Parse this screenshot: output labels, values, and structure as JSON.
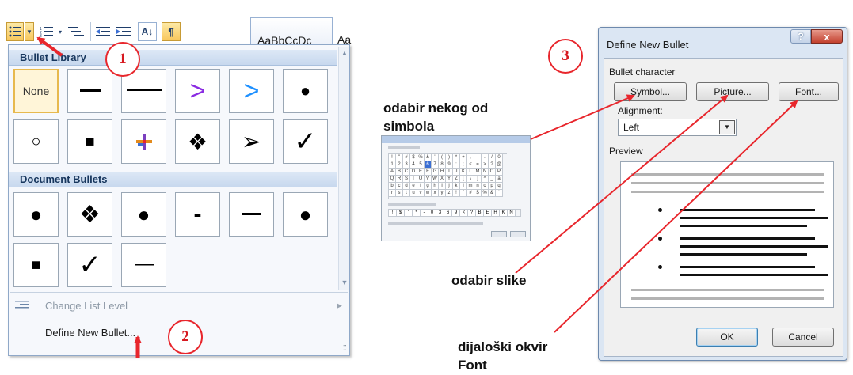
{
  "ribbon": {
    "style_preview_1": "AaBbCcDc",
    "style_preview_2": "Aa",
    "sort_icon_text": "A↓",
    "pilcrow": "¶"
  },
  "gallery": {
    "bullet_library_heading": "Bullet Library",
    "library_items": [
      {
        "label": "None",
        "icon": "none"
      },
      {
        "label": "—",
        "icon": "short-dash-bullet"
      },
      {
        "label": "——",
        "icon": "long-dash-bullet"
      },
      {
        "label": ">",
        "icon": "purple-chevron-bullet"
      },
      {
        "label": ">",
        "icon": "blue-chevron-bullet"
      },
      {
        "label": "●",
        "icon": "filled-circle-bullet"
      },
      {
        "label": "○",
        "icon": "hollow-circle-bullet"
      },
      {
        "label": "■",
        "icon": "filled-square-bullet"
      },
      {
        "label": "✢",
        "icon": "color-cross-bullet"
      },
      {
        "label": "❖",
        "icon": "diamond-cluster-bullet"
      },
      {
        "label": "➢",
        "icon": "arrowhead-bullet"
      },
      {
        "label": "✓",
        "icon": "checkmark-bullet"
      }
    ],
    "document_bullets_heading": "Document Bullets",
    "document_items": [
      {
        "label": "●",
        "icon": "filled-circle-bullet"
      },
      {
        "label": "❖",
        "icon": "diamond-cluster-bullet"
      },
      {
        "label": "●",
        "icon": "filled-circle-bullet"
      },
      {
        "label": "-",
        "icon": "hyphen-bullet"
      },
      {
        "label": "—",
        "icon": "dash-bullet"
      },
      {
        "label": "●",
        "icon": "filled-circle-bullet"
      },
      {
        "label": "■",
        "icon": "filled-square-bullet"
      },
      {
        "label": "✓",
        "icon": "checkmark-bullet"
      },
      {
        "label": "—",
        "icon": "thin-dash-bullet"
      }
    ],
    "change_list_level": "Change List Level",
    "define_new_bullet": "Define New Bullet..."
  },
  "callouts": {
    "one": "1",
    "two": "2",
    "three": "3"
  },
  "annotations": {
    "symbol_line1": "odabir nekog od",
    "symbol_line2": "simbola",
    "picture": "odabir slike",
    "font_line1": "dijaloški okvir",
    "font_line2": "Font"
  },
  "dialog": {
    "title": "Define New Bullet",
    "help": "?",
    "close": "x",
    "bullet_character": "Bullet character",
    "symbol_button": "Symbol...",
    "picture_button": "Picture...",
    "font_button": "Font...",
    "alignment_label": "Alignment:",
    "alignment_value": "Left",
    "preview_label": "Preview",
    "ok_button": "OK",
    "cancel_button": "Cancel"
  },
  "colors": {
    "callout_red": "#e8262c",
    "arrow_red": "#e8262c",
    "gallery_header": "#c7d8ee",
    "selected_cell": "#fff5d8",
    "purple_chevron": "#8a2be2",
    "blue_chevron": "#1e90ff"
  }
}
